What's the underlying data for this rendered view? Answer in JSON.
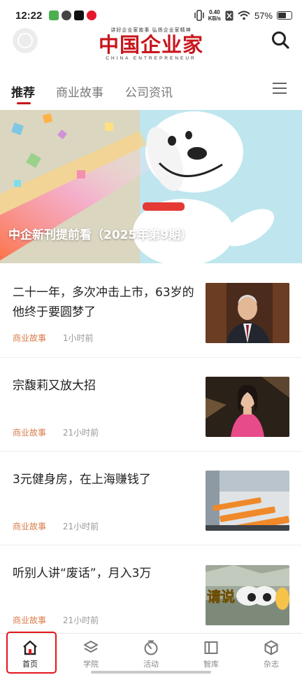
{
  "status_bar": {
    "time": "12:22",
    "net_speed_value": "0.40",
    "net_speed_unit": "KB/s",
    "battery": "57%"
  },
  "header": {
    "logo_slogan": "讲好企业家故事  弘扬企业家精神",
    "logo_title": "中国企业家",
    "logo_subtitle": "CHINA ENTREPRENEUR",
    "search_icon": "search-icon",
    "avatar_icon": "avatar-icon"
  },
  "tabs": [
    {
      "label": "推荐",
      "active": true
    },
    {
      "label": "商业故事",
      "active": false
    },
    {
      "label": "公司资讯",
      "active": false
    }
  ],
  "accent_color": "#c8161d",
  "banner": {
    "caption": "中企新刊提前看（2025年第9期）"
  },
  "articles": [
    {
      "title": "二十一年，多次冲击上市，63岁的他终于要圆梦了",
      "category": "商业故事",
      "time": "1小时前"
    },
    {
      "title": "宗馥莉又放大招",
      "category": "商业故事",
      "time": "21小时前"
    },
    {
      "title": "3元健身房，在上海赚钱了",
      "category": "商业故事",
      "time": "21小时前"
    },
    {
      "title": "听别人讲“废话”，月入3万",
      "category": "商业故事",
      "time": "21小时前"
    }
  ],
  "thumb_text": {
    "article_4": "请说"
  },
  "bottom_nav": [
    {
      "label": "首页",
      "icon": "home-icon",
      "active": true
    },
    {
      "label": "学院",
      "icon": "layers-icon",
      "active": false
    },
    {
      "label": "活动",
      "icon": "timer-icon",
      "active": false
    },
    {
      "label": "智库",
      "icon": "book-icon",
      "active": false
    },
    {
      "label": "杂志",
      "icon": "cube-icon",
      "active": false
    }
  ]
}
